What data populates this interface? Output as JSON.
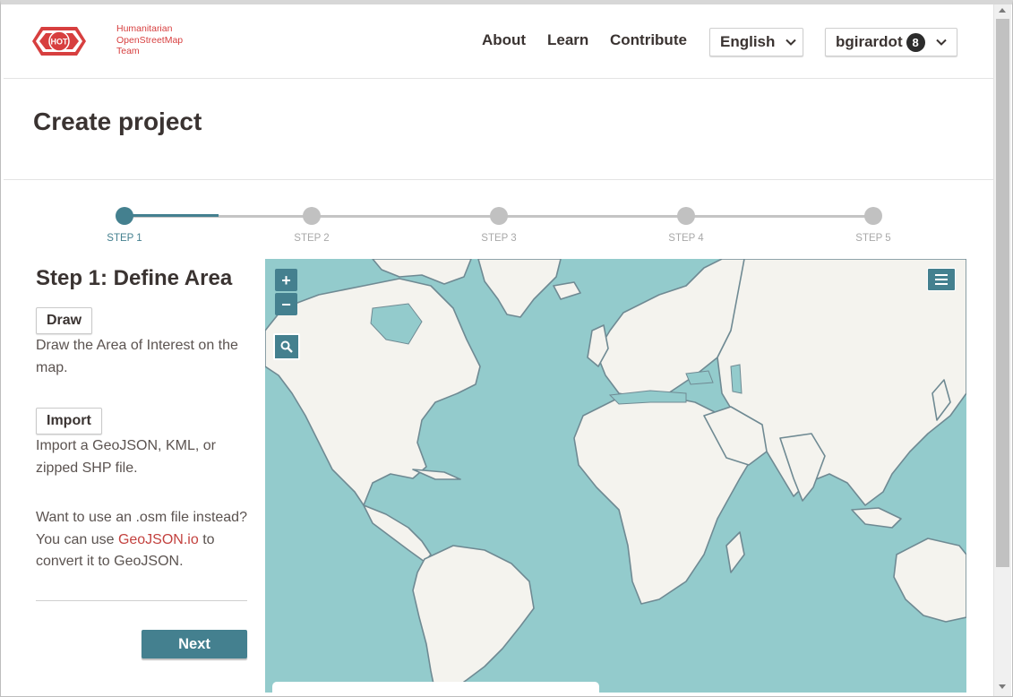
{
  "header": {
    "logo_badge": "HOT",
    "logo_line1": "Humanitarian",
    "logo_line2": "OpenStreetMap",
    "logo_line3": "Team",
    "nav": {
      "about": "About",
      "learn": "Learn",
      "contribute": "Contribute"
    },
    "language": "English",
    "user": {
      "name": "bgirardot",
      "notifications": "8"
    }
  },
  "page": {
    "title": "Create project"
  },
  "stepper": {
    "steps": [
      "STEP 1",
      "STEP 2",
      "STEP 3",
      "STEP 4",
      "STEP 5"
    ],
    "current": 1,
    "colors": {
      "active": "#44808f",
      "inactive": "#c1c1c1"
    }
  },
  "panel": {
    "heading": "Step 1: Define Area",
    "draw_label": "Draw",
    "draw_desc": "Draw the Area of Interest on the map.",
    "import_label": "Import",
    "import_desc": "Import a GeoJSON, KML, or zipped SHP file.",
    "osm_text_1": "Want to use an .osm file instead? You can use ",
    "osm_link": "GeoJSON.io",
    "osm_text_2": " to convert it to GeoJSON.",
    "next_label": "Next"
  },
  "map": {
    "zoom_in": "+",
    "zoom_out": "−",
    "icons": [
      "search-icon",
      "layers-icon"
    ],
    "colors": {
      "water": "#93cbcc",
      "land": "#f4f3ee",
      "border": "#6f8a93"
    }
  }
}
